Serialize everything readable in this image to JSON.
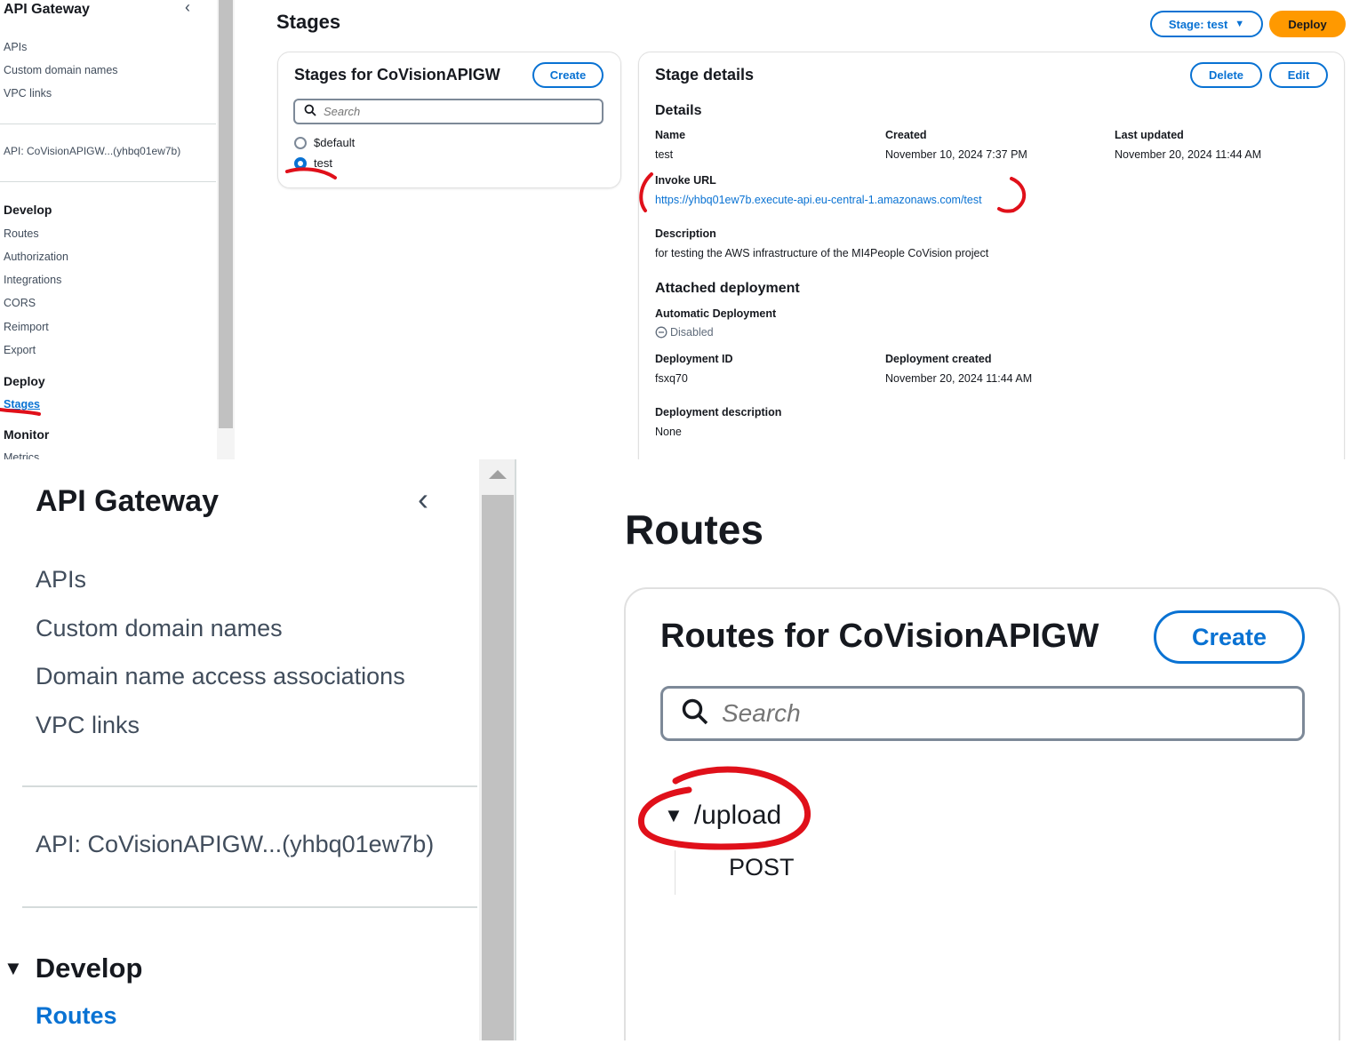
{
  "top": {
    "sidebar": {
      "title": "API Gateway",
      "collapse_glyph": "‹",
      "nav_links": [
        "APIs",
        "Custom domain names",
        "VPC links"
      ],
      "api_label": "API: CoVisionAPIGW...(yhbq01ew7b)",
      "develop_heading": "Develop",
      "develop_items": [
        "Routes",
        "Authorization",
        "Integrations",
        "CORS",
        "Reimport",
        "Export"
      ],
      "deploy_heading": "Deploy",
      "deploy_items": [
        "Stages"
      ],
      "monitor_heading": "Monitor",
      "monitor_items": [
        "Metrics"
      ]
    },
    "page_title": "Stages",
    "stage_selector_label": "Stage: test",
    "deploy_label": "Deploy",
    "stages_panel": {
      "title": "Stages for CoVisionAPIGW",
      "create_label": "Create",
      "search_placeholder": "Search",
      "options": [
        {
          "label": "$default",
          "selected": false
        },
        {
          "label": "test",
          "selected": true
        }
      ]
    },
    "details_panel": {
      "title": "Stage details",
      "delete_label": "Delete",
      "edit_label": "Edit",
      "section_details": "Details",
      "name_label": "Name",
      "name_value": "test",
      "created_label": "Created",
      "created_value": "November 10, 2024 7:37 PM",
      "updated_label": "Last updated",
      "updated_value": "November 20, 2024 11:44 AM",
      "invoke_label": "Invoke URL",
      "invoke_url": "https://yhbq01ew7b.execute-api.eu-central-1.amazonaws.com/test",
      "description_label": "Description",
      "description_value": "for testing the AWS infrastructure of the MI4People CoVision project",
      "section_deployment": "Attached deployment",
      "auto_label": "Automatic Deployment",
      "auto_value": "Disabled",
      "deploy_id_label": "Deployment ID",
      "deploy_id_value": "fsxq70",
      "deploy_created_label": "Deployment created",
      "deploy_created_value": "November 20, 2024 11:44 AM",
      "deploy_desc_label": "Deployment description",
      "deploy_desc_value": "None"
    }
  },
  "bottom": {
    "sidebar": {
      "title": "API Gateway",
      "collapse_glyph": "‹",
      "nav_links": [
        "APIs",
        "Custom domain names",
        "Domain name access associations",
        "VPC links"
      ],
      "api_label": "API: CoVisionAPIGW...(yhbq01ew7b)",
      "develop_heading": "Develop",
      "active_item": "Routes"
    },
    "page_title": "Routes",
    "routes_panel": {
      "title": "Routes for CoVisionAPIGW",
      "create_label": "Create",
      "search_placeholder": "Search",
      "route_path": "/upload",
      "route_method": "POST"
    }
  },
  "colors": {
    "accent_blue": "#0972d3",
    "deploy_orange": "#ff9900",
    "annotation_red": "#e0101a"
  }
}
